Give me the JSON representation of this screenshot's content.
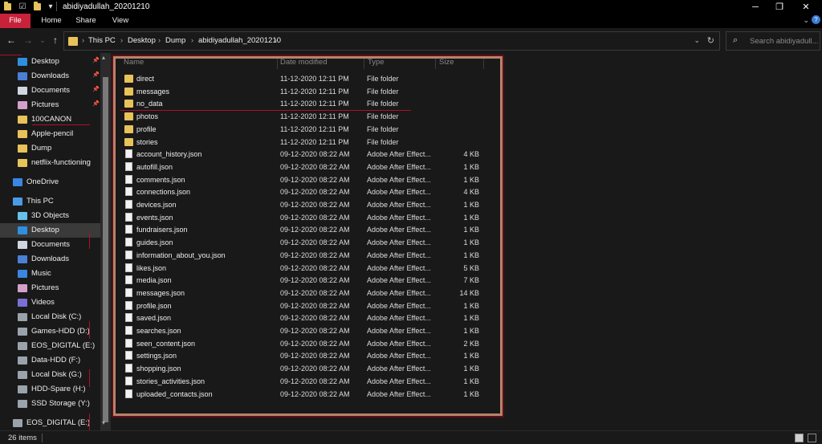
{
  "window": {
    "title": "abidiyadullah_20201210"
  },
  "ribbon": {
    "tabs": [
      "File",
      "Home",
      "Share",
      "View"
    ]
  },
  "address": {
    "crumbs": [
      "This PC",
      "Desktop",
      "Dump",
      "abidiyadullah_20201210"
    ]
  },
  "search": {
    "placeholder": "Search abidiyadull..."
  },
  "sidebar": {
    "items": [
      {
        "label": "Desktop",
        "icon": "desktop-icon",
        "pinned": true
      },
      {
        "label": "Downloads",
        "icon": "download-icon",
        "pinned": true
      },
      {
        "label": "Documents",
        "icon": "documents-icon",
        "pinned": true
      },
      {
        "label": "Pictures",
        "icon": "pictures-icon",
        "pinned": true
      },
      {
        "label": "100CANON",
        "icon": "folder-icon"
      },
      {
        "label": "Apple-pencil",
        "icon": "folder-icon"
      },
      {
        "label": "Dump",
        "icon": "folder-icon"
      },
      {
        "label": "netflix-functioning",
        "icon": "folder-icon"
      },
      {
        "label": "OneDrive",
        "icon": "cloud-icon"
      },
      {
        "label": "This PC",
        "icon": "computer-icon"
      },
      {
        "label": "3D Objects",
        "icon": "3d-objects-icon"
      },
      {
        "label": "Desktop",
        "icon": "desktop-icon",
        "selected": true
      },
      {
        "label": "Documents",
        "icon": "documents-icon"
      },
      {
        "label": "Downloads",
        "icon": "download-icon"
      },
      {
        "label": "Music",
        "icon": "music-icon"
      },
      {
        "label": "Pictures",
        "icon": "pictures-icon"
      },
      {
        "label": "Videos",
        "icon": "videos-icon"
      },
      {
        "label": "Local Disk (C:)",
        "icon": "drive-icon"
      },
      {
        "label": "Games-HDD (D:)",
        "icon": "drive-icon"
      },
      {
        "label": "EOS_DIGITAL (E:)",
        "icon": "drive-icon"
      },
      {
        "label": "Data-HDD (F:)",
        "icon": "drive-icon"
      },
      {
        "label": "Local Disk (G:)",
        "icon": "drive-icon"
      },
      {
        "label": "HDD-Spare (H:)",
        "icon": "drive-icon"
      },
      {
        "label": "SSD Storage (Y:)",
        "icon": "drive-icon"
      },
      {
        "label": "EOS_DIGITAL (E:)",
        "icon": "drive-icon"
      }
    ]
  },
  "columns": {
    "name": "Name",
    "date": "Date modified",
    "type": "Type",
    "size": "Size"
  },
  "files": [
    {
      "name": "direct",
      "date": "11-12-2020 12:11 PM",
      "type": "File folder",
      "size": "",
      "kind": "folder"
    },
    {
      "name": "messages",
      "date": "11-12-2020 12:11 PM",
      "type": "File folder",
      "size": "",
      "kind": "folder"
    },
    {
      "name": "no_data",
      "date": "11-12-2020 12:11 PM",
      "type": "File folder",
      "size": "",
      "kind": "folder"
    },
    {
      "name": "photos",
      "date": "11-12-2020 12:11 PM",
      "type": "File folder",
      "size": "",
      "kind": "folder"
    },
    {
      "name": "profile",
      "date": "11-12-2020 12:11 PM",
      "type": "File folder",
      "size": "",
      "kind": "folder"
    },
    {
      "name": "stories",
      "date": "11-12-2020 12:11 PM",
      "type": "File folder",
      "size": "",
      "kind": "folder"
    },
    {
      "name": "account_history.json",
      "date": "09-12-2020 08:22 AM",
      "type": "Adobe After Effect...",
      "size": "4 KB",
      "kind": "file"
    },
    {
      "name": "autofill.json",
      "date": "09-12-2020 08:22 AM",
      "type": "Adobe After Effect...",
      "size": "1 KB",
      "kind": "file"
    },
    {
      "name": "comments.json",
      "date": "09-12-2020 08:22 AM",
      "type": "Adobe After Effect...",
      "size": "1 KB",
      "kind": "file"
    },
    {
      "name": "connections.json",
      "date": "09-12-2020 08:22 AM",
      "type": "Adobe After Effect...",
      "size": "4 KB",
      "kind": "file"
    },
    {
      "name": "devices.json",
      "date": "09-12-2020 08:22 AM",
      "type": "Adobe After Effect...",
      "size": "1 KB",
      "kind": "file"
    },
    {
      "name": "events.json",
      "date": "09-12-2020 08:22 AM",
      "type": "Adobe After Effect...",
      "size": "1 KB",
      "kind": "file"
    },
    {
      "name": "fundraisers.json",
      "date": "09-12-2020 08:22 AM",
      "type": "Adobe After Effect...",
      "size": "1 KB",
      "kind": "file"
    },
    {
      "name": "guides.json",
      "date": "09-12-2020 08:22 AM",
      "type": "Adobe After Effect...",
      "size": "1 KB",
      "kind": "file"
    },
    {
      "name": "information_about_you.json",
      "date": "09-12-2020 08:22 AM",
      "type": "Adobe After Effect...",
      "size": "1 KB",
      "kind": "file"
    },
    {
      "name": "likes.json",
      "date": "09-12-2020 08:22 AM",
      "type": "Adobe After Effect...",
      "size": "5 KB",
      "kind": "file"
    },
    {
      "name": "media.json",
      "date": "09-12-2020 08:22 AM",
      "type": "Adobe After Effect...",
      "size": "7 KB",
      "kind": "file"
    },
    {
      "name": "messages.json",
      "date": "09-12-2020 08:22 AM",
      "type": "Adobe After Effect...",
      "size": "14 KB",
      "kind": "file"
    },
    {
      "name": "profile.json",
      "date": "09-12-2020 08:22 AM",
      "type": "Adobe After Effect...",
      "size": "1 KB",
      "kind": "file"
    },
    {
      "name": "saved.json",
      "date": "09-12-2020 08:22 AM",
      "type": "Adobe After Effect...",
      "size": "1 KB",
      "kind": "file"
    },
    {
      "name": "searches.json",
      "date": "09-12-2020 08:22 AM",
      "type": "Adobe After Effect...",
      "size": "1 KB",
      "kind": "file"
    },
    {
      "name": "seen_content.json",
      "date": "09-12-2020 08:22 AM",
      "type": "Adobe After Effect...",
      "size": "2 KB",
      "kind": "file"
    },
    {
      "name": "settings.json",
      "date": "09-12-2020 08:22 AM",
      "type": "Adobe After Effect...",
      "size": "1 KB",
      "kind": "file"
    },
    {
      "name": "shopping.json",
      "date": "09-12-2020 08:22 AM",
      "type": "Adobe After Effect...",
      "size": "1 KB",
      "kind": "file"
    },
    {
      "name": "stories_activities.json",
      "date": "09-12-2020 08:22 AM",
      "type": "Adobe After Effect...",
      "size": "1 KB",
      "kind": "file"
    },
    {
      "name": "uploaded_contacts.json",
      "date": "09-12-2020 08:22 AM",
      "type": "Adobe After Effect...",
      "size": "1 KB",
      "kind": "file"
    }
  ],
  "status": {
    "count": "26 items"
  },
  "colors": {
    "accent": "#c7223a",
    "folder": "#e8c25a",
    "frame": "#b8836a",
    "selection": "#3a3a3a"
  }
}
